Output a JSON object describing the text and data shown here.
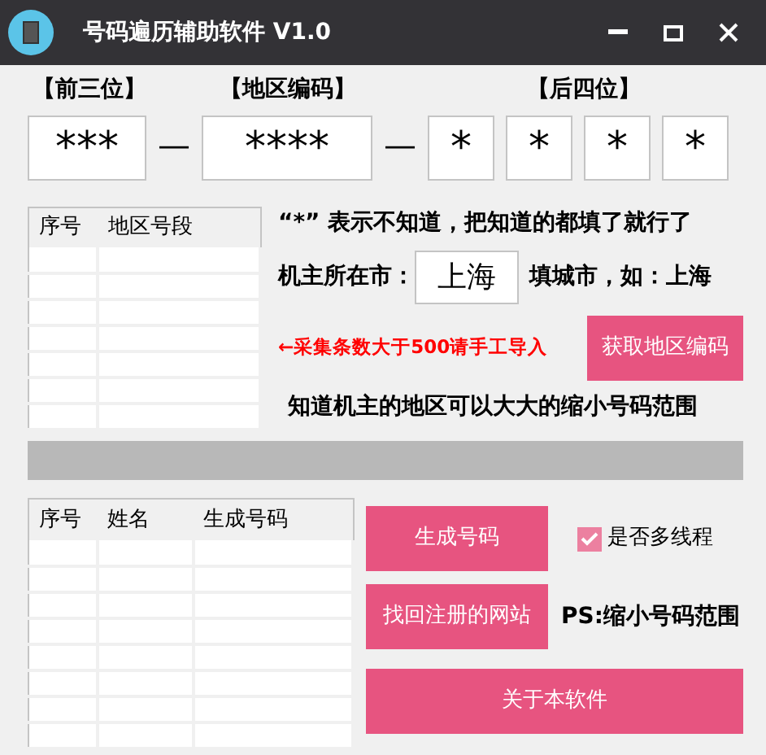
{
  "window": {
    "title": "号码遍历辅助软件 V1.0"
  },
  "number_parts": [
    {
      "label": "【前三位】",
      "fields": [
        {
          "value": "***"
        }
      ]
    },
    {
      "separator": "—",
      "label": "【地区编码】",
      "fields": [
        {
          "value": "****"
        }
      ]
    },
    {
      "separator": "—",
      "label": "【后四位】",
      "fields": [
        {
          "value": "*"
        },
        {
          "value": "*"
        },
        {
          "value": "*"
        },
        {
          "value": "*"
        }
      ]
    }
  ],
  "area_table": {
    "columns": [
      "序号",
      "地区号段"
    ]
  },
  "hint": "“*” 表示不知道，把知道的都填了就行了",
  "city": {
    "label": "机主所在市：",
    "value": "上海",
    "note": "填城市，如：上海"
  },
  "warning": "←采集条数大于500请手工导入",
  "get_code_button": "获取地区编码",
  "area_tip": "知道机主的地区可以大大的缩小号码范围",
  "result_table": {
    "columns": [
      "序号",
      "姓名",
      "生成号码"
    ]
  },
  "generate_button": "生成号码",
  "multithread": {
    "label": "是否多线程",
    "checked": true
  },
  "site_button": "找回注册的网站",
  "ps_note": "PS:缩小号码范围",
  "about_button": "关于本软件"
}
